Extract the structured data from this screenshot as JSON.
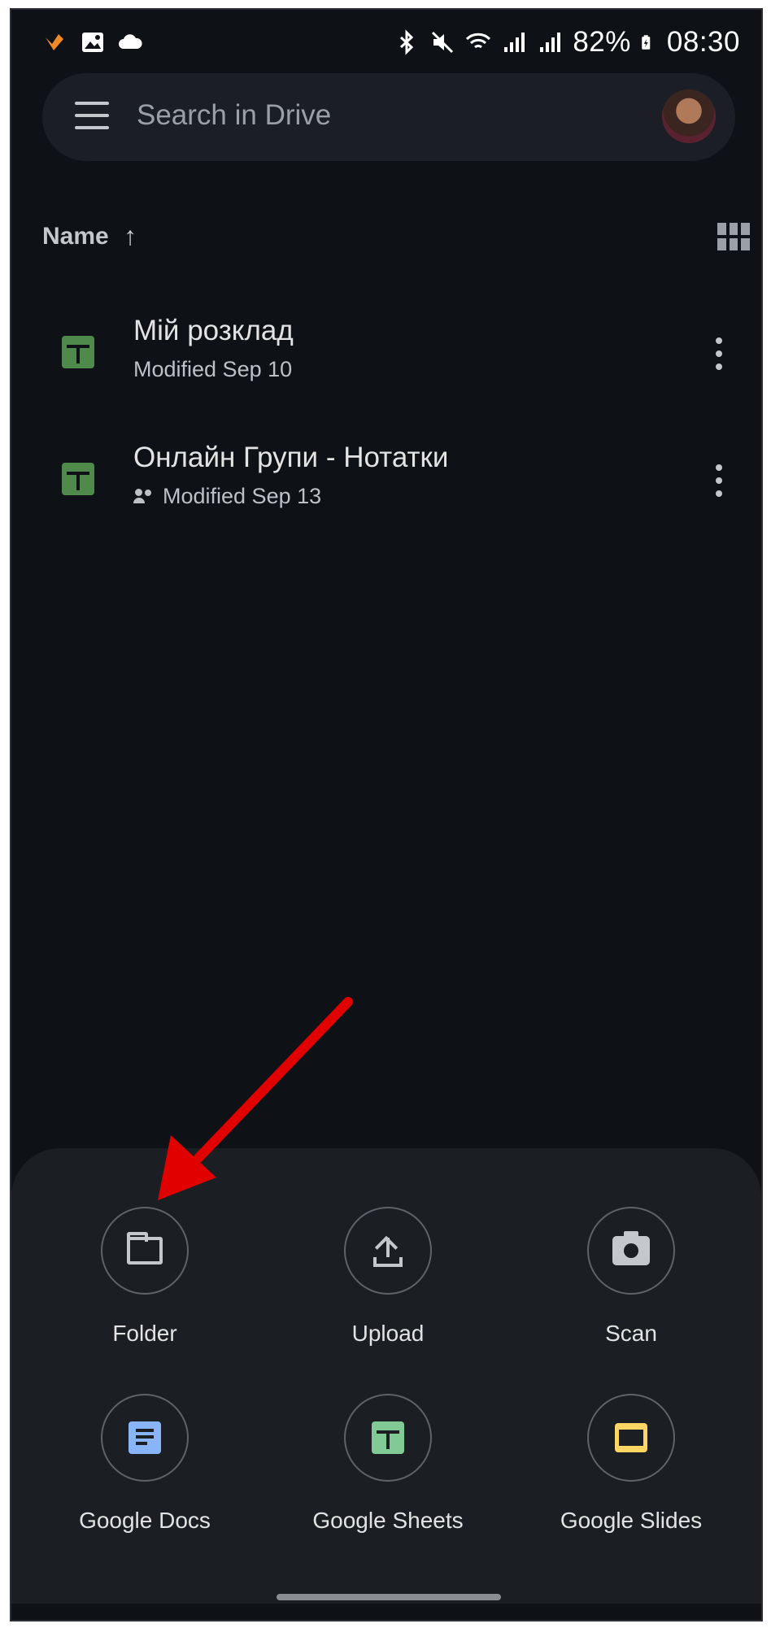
{
  "status_bar": {
    "battery": "82%",
    "time": "08:30",
    "icons_left": [
      "notification-icon",
      "gallery-icon",
      "cloud-icon"
    ],
    "icons_right": [
      "bluetooth-icon",
      "mute-icon",
      "wifi-icon",
      "signal-icon",
      "signal-icon",
      "battery-charging-icon"
    ]
  },
  "search": {
    "placeholder": "Search in Drive"
  },
  "sort": {
    "label": "Name",
    "direction_icon": "↑"
  },
  "files": [
    {
      "name": "Мій розклад",
      "meta": "Modified Sep 10",
      "shared": false,
      "type": "google-sheets"
    },
    {
      "name": "Онлайн Групи - Нотатки",
      "meta": "Modified Sep 13",
      "shared": true,
      "type": "google-sheets"
    }
  ],
  "create_sheet": {
    "actions": [
      {
        "label": "Folder",
        "icon": "folder-icon"
      },
      {
        "label": "Upload",
        "icon": "upload-icon"
      },
      {
        "label": "Scan",
        "icon": "camera-icon"
      },
      {
        "label": "Google Docs",
        "icon": "google-docs-icon"
      },
      {
        "label": "Google Sheets",
        "icon": "google-sheets-icon"
      },
      {
        "label": "Google Slides",
        "icon": "google-slides-icon"
      }
    ]
  },
  "colors": {
    "background": "#0e1116",
    "sheet": "#1b1e22",
    "sheets_green": "#4f8a4c",
    "docs_blue": "#8ab4f8",
    "slides_yellow": "#fdd663",
    "annotation_red": "#e00000"
  }
}
